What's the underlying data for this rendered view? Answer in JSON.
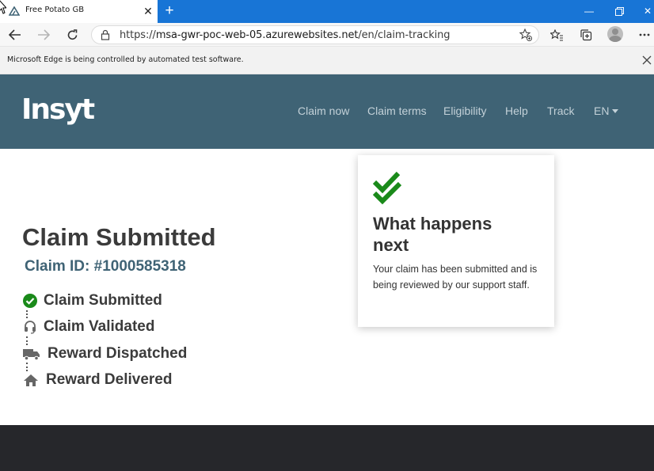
{
  "browser": {
    "tab_title": "Free Potato GB",
    "new_tab_symbol": "+",
    "url_prefix": "https://",
    "url_host": "msa-gwr-poc-web-05.azurewebsites.net",
    "url_path": "/en/claim-tracking",
    "infobar_text": "Microsoft Edge is being controlled by automated test software."
  },
  "site": {
    "logo": "Insyt",
    "nav": {
      "claim_now": "Claim now",
      "claim_terms": "Claim terms",
      "eligibility": "Eligibility",
      "help": "Help",
      "track": "Track",
      "language": "EN"
    }
  },
  "main": {
    "title": "Claim Submitted",
    "claim_id": "Claim ID: #1000585318",
    "steps": [
      {
        "label": "Claim Submitted",
        "icon": "check-circle-icon",
        "status": "complete"
      },
      {
        "label": "Claim Validated",
        "icon": "headset-icon",
        "status": "pending"
      },
      {
        "label": "Reward Dispatched",
        "icon": "truck-icon",
        "status": "pending"
      },
      {
        "label": "Reward Delivered",
        "icon": "home-icon",
        "status": "pending"
      }
    ]
  },
  "card": {
    "title": "What happens next",
    "text": "Your claim has been submitted and is being reviewed by our support staff."
  },
  "colors": {
    "header_bg": "#3f6375",
    "accent_green": "#1a8a1a",
    "footer_bg": "#26272b",
    "titlebar_blue": "#1875d6"
  }
}
